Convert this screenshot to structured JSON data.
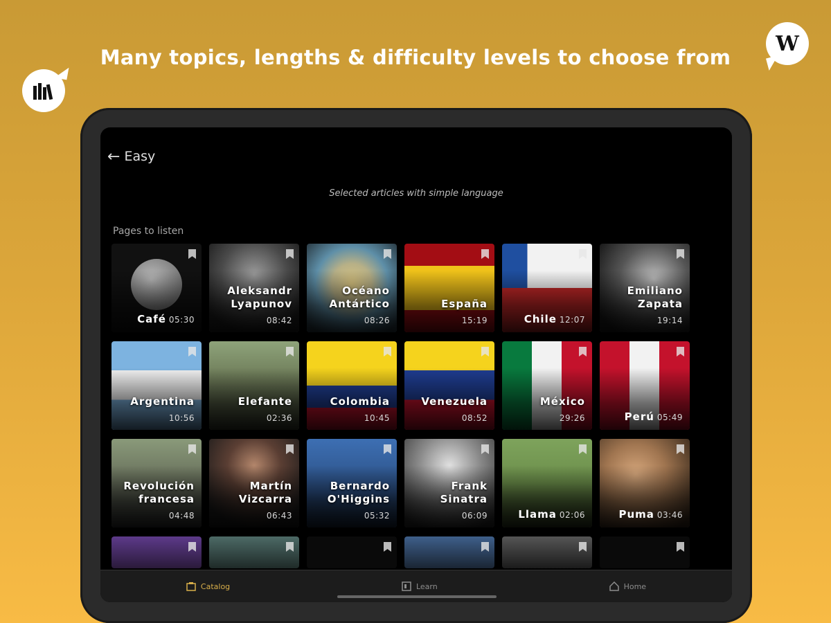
{
  "headline": "Many topics, lengths & difficulty levels to choose from",
  "logo_right": "W",
  "header": {
    "back_arrow": "←",
    "title": "Easy"
  },
  "subtitle": "Selected articles with simple language",
  "section_title": "Pages to listen",
  "cards": [
    {
      "name": "Café",
      "duration": "05:30"
    },
    {
      "name": "Aleksandr Lyapunov",
      "duration": "08:42"
    },
    {
      "name": "Océano Antártico",
      "duration": "08:26"
    },
    {
      "name": "España",
      "duration": "15:19"
    },
    {
      "name": "Chile",
      "duration": "12:07"
    },
    {
      "name": "Emiliano Zapata",
      "duration": "19:14"
    },
    {
      "name": "Argentina",
      "duration": "10:56"
    },
    {
      "name": "Elefante",
      "duration": "02:36"
    },
    {
      "name": "Colombia",
      "duration": "10:45"
    },
    {
      "name": "Venezuela",
      "duration": "08:52"
    },
    {
      "name": "México",
      "duration": "29:26"
    },
    {
      "name": "Perú",
      "duration": "05:49"
    },
    {
      "name": "Revolución francesa",
      "duration": "04:48"
    },
    {
      "name": "Martín Vizcarra",
      "duration": "06:43"
    },
    {
      "name": "Bernardo O'Higgins",
      "duration": "05:32"
    },
    {
      "name": "Frank Sinatra",
      "duration": "06:09"
    },
    {
      "name": "Llama",
      "duration": "02:06"
    },
    {
      "name": "Puma",
      "duration": "03:46"
    }
  ],
  "bottom_nav": [
    {
      "label": "Catalog",
      "active": true
    },
    {
      "label": "Learn",
      "active": false
    },
    {
      "label": "Home",
      "active": false
    }
  ],
  "colors": {
    "background_top": "#c99a35",
    "background_bottom": "#f8bb45",
    "accent": "#d8ae4a"
  }
}
